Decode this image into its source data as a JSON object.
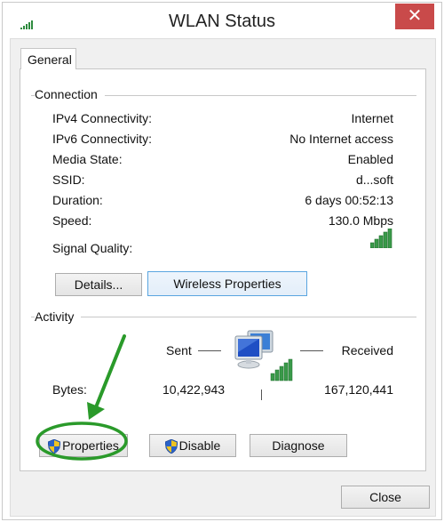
{
  "window": {
    "title": "WLAN Status",
    "close_glyph": "✕"
  },
  "tabs": [
    {
      "label": "General",
      "selected": true
    }
  ],
  "connection": {
    "group_title": "Connection",
    "rows": [
      {
        "label": "IPv4 Connectivity:",
        "value": "Internet"
      },
      {
        "label": "IPv6 Connectivity:",
        "value": "No Internet access"
      },
      {
        "label": "Media State:",
        "value": "Enabled"
      },
      {
        "label": "SSID:",
        "value": "d...soft"
      },
      {
        "label": "Duration:",
        "value": "6 days 00:52:13"
      },
      {
        "label": "Speed:",
        "value": "130.0 Mbps"
      }
    ],
    "signal_quality_label": "Signal Quality:",
    "signal_quality_bars": 5,
    "signal_quality_max_bars": 5,
    "buttons": {
      "details": "Details...",
      "wireless_properties": "Wireless Properties"
    }
  },
  "activity": {
    "group_title": "Activity",
    "sent_label": "Sent",
    "received_label": "Received",
    "bytes_label": "Bytes:",
    "bytes_sent": "10,422,943",
    "bytes_received": "167,120,441",
    "buttons": {
      "properties": "Properties",
      "disable": "Disable",
      "diagnose": "Diagnose"
    }
  },
  "footer": {
    "close_label": "Close"
  },
  "annotation": {
    "color": "#2a9a2a",
    "target": "Properties"
  }
}
